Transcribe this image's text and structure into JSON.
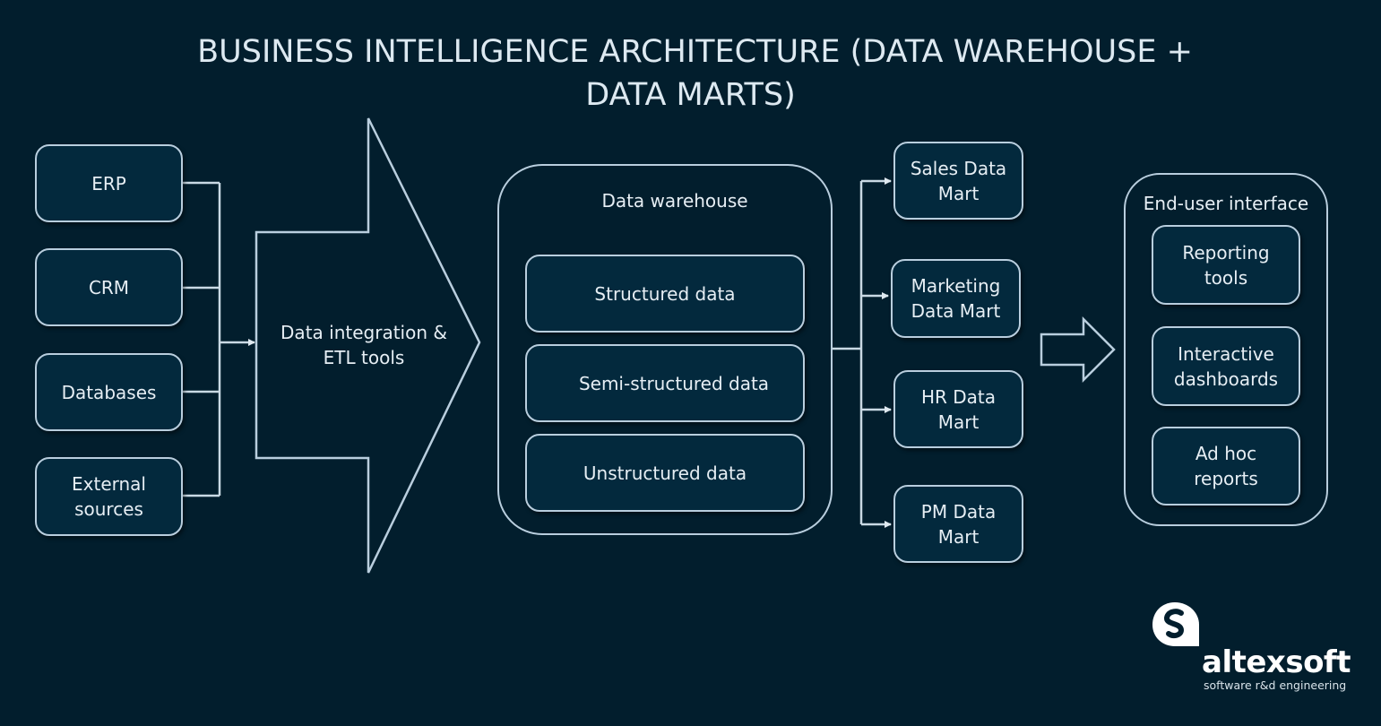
{
  "title": {
    "line1": "BUSINESS INTELLIGENCE ARCHITECTURE (DATA WAREHOUSE +",
    "line2": "DATA MARTS)"
  },
  "sources": [
    {
      "label": "ERP"
    },
    {
      "label": "CRM"
    },
    {
      "label": "Databases"
    },
    {
      "label": "External sources"
    }
  ],
  "etl": {
    "label": "Data integration & ETL tools"
  },
  "warehouse": {
    "title": "Data warehouse",
    "items": [
      {
        "label": "Structured data"
      },
      {
        "label": "Semi-structured data"
      },
      {
        "label": "Unstructured data"
      }
    ]
  },
  "data_marts": [
    {
      "label": "Sales Data Mart"
    },
    {
      "label": "Marketing Data Mart"
    },
    {
      "label": "HR Data Mart"
    },
    {
      "label": "PM Data Mart"
    }
  ],
  "end_user": {
    "title": "End-user interface",
    "items": [
      {
        "label": "Reporting tools"
      },
      {
        "label": "Interactive dashboards"
      },
      {
        "label": "Ad hoc reports"
      }
    ]
  },
  "brand": {
    "name": "altexsoft",
    "tagline": "software r&d engineering"
  },
  "colors": {
    "background": "#021e2d",
    "box_fill": "#03293d",
    "stroke": "#b9cede",
    "text": "#e6eef4"
  }
}
